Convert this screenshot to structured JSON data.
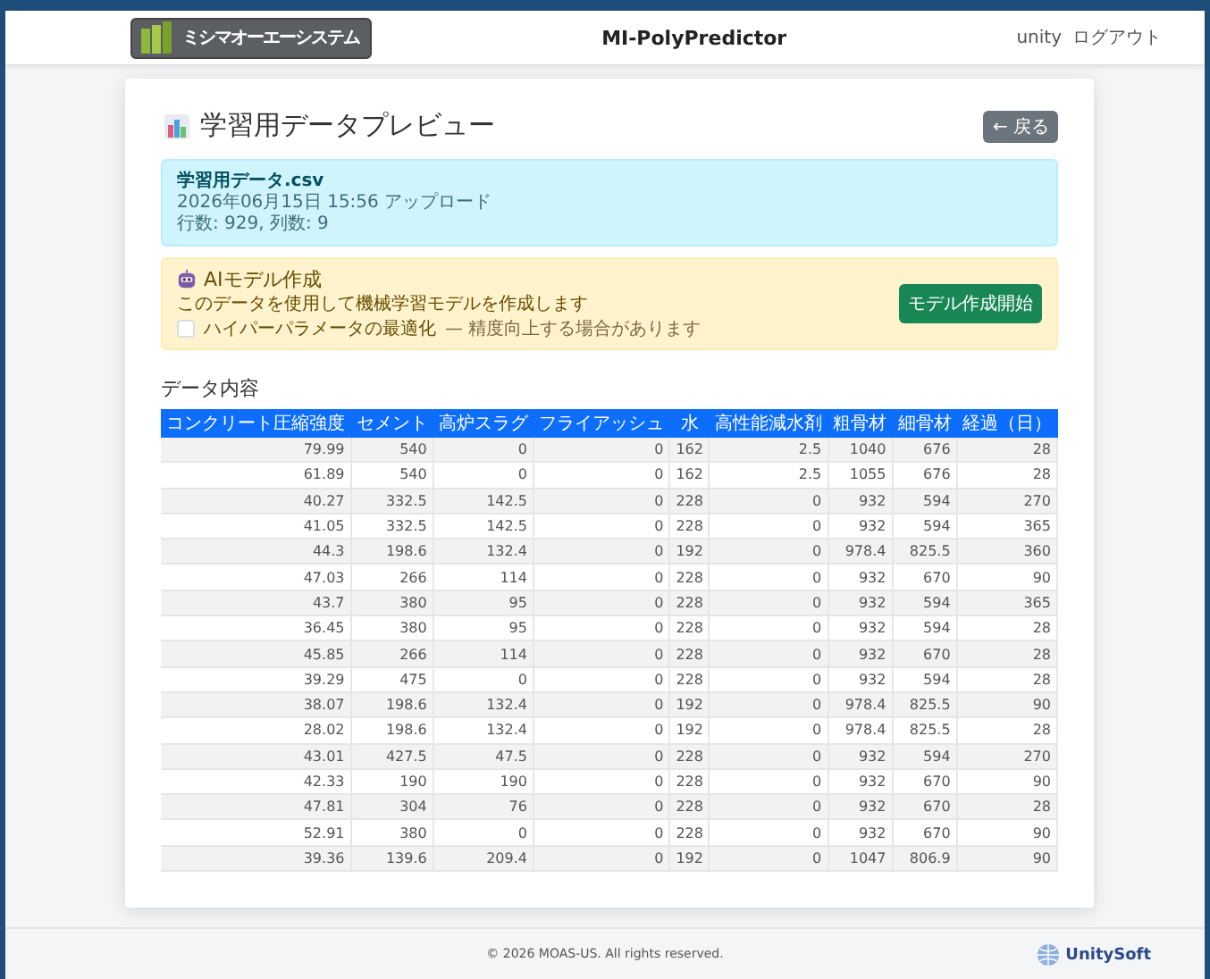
{
  "header": {
    "logo_text": "ミシマオーエーシステム",
    "app_title": "MI-PolyPredictor",
    "user": "unity",
    "logout": "ログアウト"
  },
  "page": {
    "title": "学習用データプレビュー",
    "back_button": "← 戻る"
  },
  "file_info": {
    "name": "学習用データ.csv",
    "uploaded": "2026年06月15日 15:56 アップロード",
    "size": "行数: 929, 列数: 9"
  },
  "ai_model": {
    "title": "AIモデル作成",
    "description": "このデータを使用して機械学習モデルを作成します",
    "option": {
      "label": "ハイパーパラメータの最適化",
      "note": "— 精度向上する場合があります",
      "checked": false
    },
    "button": "モデル作成開始"
  },
  "table": {
    "heading": "データ内容",
    "columns": [
      "コンクリート圧縮強度",
      "セメント",
      "高炉スラグ",
      "フライアッシュ",
      "水",
      "高性能減水剤",
      "粗骨材",
      "細骨材",
      "経過（日）"
    ],
    "rows": [
      [
        "79.99",
        "540",
        "0",
        "0",
        "162",
        "2.5",
        "1040",
        "676",
        "28"
      ],
      [
        "61.89",
        "540",
        "0",
        "0",
        "162",
        "2.5",
        "1055",
        "676",
        "28"
      ],
      [
        "40.27",
        "332.5",
        "142.5",
        "0",
        "228",
        "0",
        "932",
        "594",
        "270"
      ],
      [
        "41.05",
        "332.5",
        "142.5",
        "0",
        "228",
        "0",
        "932",
        "594",
        "365"
      ],
      [
        "44.3",
        "198.6",
        "132.4",
        "0",
        "192",
        "0",
        "978.4",
        "825.5",
        "360"
      ],
      [
        "47.03",
        "266",
        "114",
        "0",
        "228",
        "0",
        "932",
        "670",
        "90"
      ],
      [
        "43.7",
        "380",
        "95",
        "0",
        "228",
        "0",
        "932",
        "594",
        "365"
      ],
      [
        "36.45",
        "380",
        "95",
        "0",
        "228",
        "0",
        "932",
        "594",
        "28"
      ],
      [
        "45.85",
        "266",
        "114",
        "0",
        "228",
        "0",
        "932",
        "670",
        "28"
      ],
      [
        "39.29",
        "475",
        "0",
        "0",
        "228",
        "0",
        "932",
        "594",
        "28"
      ],
      [
        "38.07",
        "198.6",
        "132.4",
        "0",
        "192",
        "0",
        "978.4",
        "825.5",
        "90"
      ],
      [
        "28.02",
        "198.6",
        "132.4",
        "0",
        "192",
        "0",
        "978.4",
        "825.5",
        "28"
      ],
      [
        "43.01",
        "427.5",
        "47.5",
        "0",
        "228",
        "0",
        "932",
        "594",
        "270"
      ],
      [
        "42.33",
        "190",
        "190",
        "0",
        "228",
        "0",
        "932",
        "670",
        "90"
      ],
      [
        "47.81",
        "304",
        "76",
        "0",
        "228",
        "0",
        "932",
        "670",
        "28"
      ],
      [
        "52.91",
        "380",
        "0",
        "0",
        "228",
        "0",
        "932",
        "670",
        "90"
      ],
      [
        "39.36",
        "139.6",
        "209.4",
        "0",
        "192",
        "0",
        "1047",
        "806.9",
        "90"
      ]
    ]
  },
  "footer": {
    "copyright": "© 2026 MOAS-US. All rights reserved.",
    "logo_text": "UnitySoft"
  }
}
